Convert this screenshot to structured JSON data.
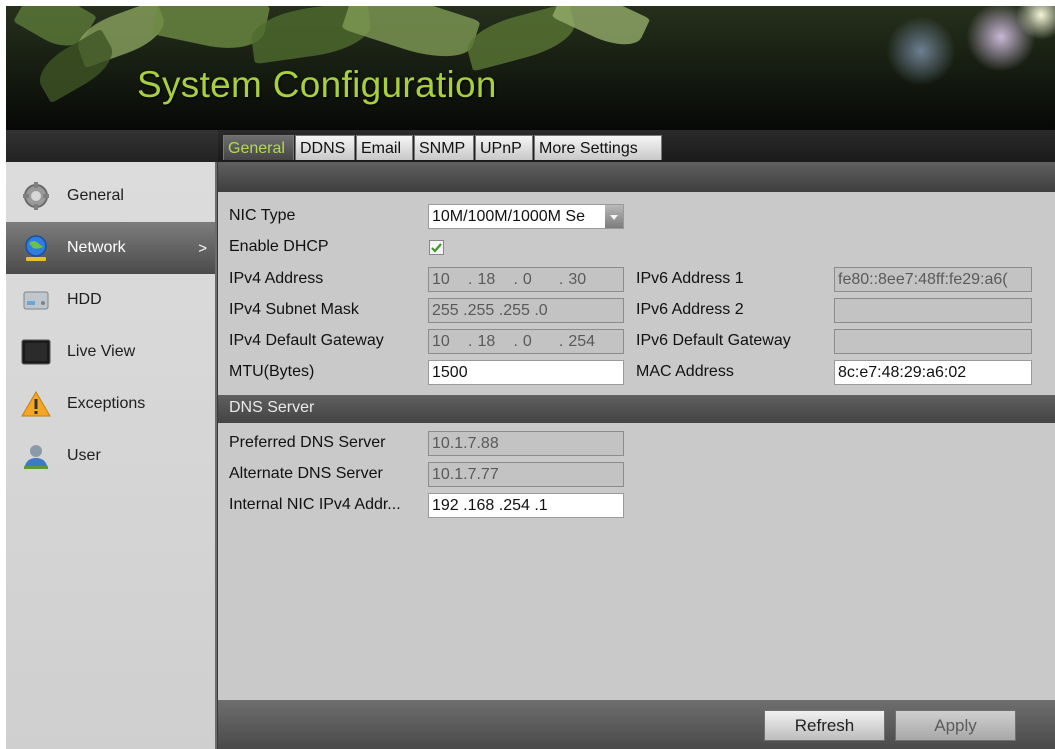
{
  "header": {
    "title": "System Configuration"
  },
  "sidebar": {
    "items": [
      {
        "label": "General",
        "icon": "gear-icon"
      },
      {
        "label": "Network",
        "icon": "globe-icon",
        "active": true,
        "arrow": ">"
      },
      {
        "label": "HDD",
        "icon": "hard-drive-icon"
      },
      {
        "label": "Live View",
        "icon": "monitor-icon"
      },
      {
        "label": "Exceptions",
        "icon": "warning-icon"
      },
      {
        "label": "User",
        "icon": "user-icon"
      }
    ]
  },
  "tabs": [
    "General",
    "DDNS",
    "Email",
    "SNMP",
    "UPnP",
    "More Settings"
  ],
  "form": {
    "nic_type": {
      "label": "NIC Type",
      "value": "10M/100M/1000M Se"
    },
    "enable_dhcp": {
      "label": "Enable DHCP",
      "checked": true
    },
    "ipv4_address": {
      "label": "IPv4 Address",
      "segments": [
        "10",
        "18",
        "0",
        "30"
      ]
    },
    "ipv4_subnet": {
      "label": "IPv4 Subnet Mask",
      "segments": [
        "255",
        "255",
        "255",
        "0"
      ]
    },
    "ipv4_gateway": {
      "label": "IPv4 Default Gateway",
      "segments": [
        "10",
        "18",
        "0",
        "254"
      ]
    },
    "mtu": {
      "label": "MTU(Bytes)",
      "value": "1500"
    },
    "ipv6_address_1": {
      "label": "IPv6 Address 1",
      "value": "fe80::8ee7:48ff:fe29:a6("
    },
    "ipv6_address_2": {
      "label": "IPv6 Address 2",
      "value": ""
    },
    "ipv6_gateway": {
      "label": "IPv6 Default Gateway",
      "value": ""
    },
    "mac_address": {
      "label": "MAC Address",
      "value": "8c:e7:48:29:a6:02"
    }
  },
  "dns": {
    "section_title": "DNS Server",
    "preferred": {
      "label": "Preferred DNS Server",
      "value": "10.1.7.88"
    },
    "alternate": {
      "label": "Alternate DNS Server",
      "value": "10.1.7.77"
    },
    "internal_nic": {
      "label": "Internal NIC IPv4 Addr...",
      "segments": [
        "192",
        "168",
        "254",
        "1"
      ]
    }
  },
  "footer": {
    "refresh_label": "Refresh",
    "apply_label": "Apply"
  },
  "colors": {
    "title_green": "#a7cf3f",
    "tab_active_text": "#b6da4a",
    "content_bg": "#c9c9c9"
  }
}
